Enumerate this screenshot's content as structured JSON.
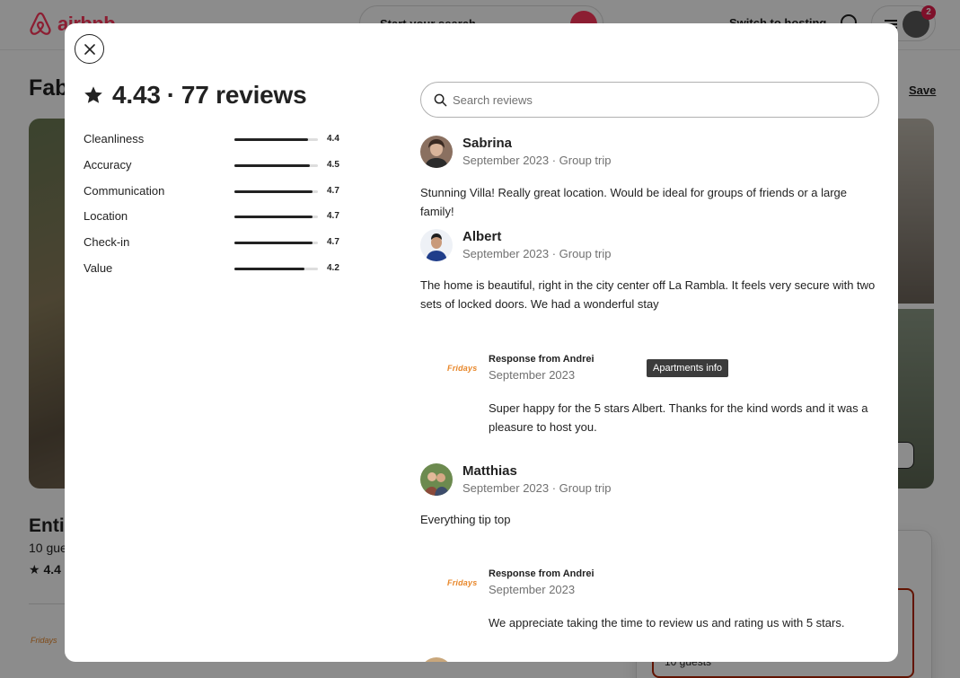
{
  "background": {
    "logo_text": "airbnb",
    "search_placeholder": "Start your search",
    "switch_to_hosting": "Switch to hosting",
    "notification_count": "2",
    "listing_title": "Fab",
    "save_label": "Save",
    "entire_label": "Enti",
    "guests_label": "10 gue",
    "rating_label": "4.4",
    "host_logo": "Fridays",
    "card_guests": "10 guests"
  },
  "modal": {
    "rating": "4.43",
    "separator": "·",
    "reviews_count": "77 reviews",
    "categories": [
      {
        "label": "Cleanliness",
        "value": "4.4",
        "score": 4.4
      },
      {
        "label": "Accuracy",
        "value": "4.5",
        "score": 4.5
      },
      {
        "label": "Communication",
        "value": "4.7",
        "score": 4.7
      },
      {
        "label": "Location",
        "value": "4.7",
        "score": 4.7
      },
      {
        "label": "Check-in",
        "value": "4.7",
        "score": 4.7
      },
      {
        "label": "Value",
        "value": "4.2",
        "score": 4.2
      }
    ],
    "search_placeholder": "Search reviews",
    "reviews": [
      {
        "name": "Sabrina",
        "meta": "September 2023 · Group trip",
        "text": "Stunning Villa! Really great location. Would be ideal for groups of friends or a large family!"
      },
      {
        "name": "Albert",
        "meta": "September 2023 · Group trip",
        "text": "The home is beautiful, right in the city center off La Rambla. It feels very secure with two sets of locked doors. We had a wonderful stay",
        "response": {
          "logo": "Fridays",
          "from": "Response from Andrei",
          "date": "September 2023",
          "text": "Super happy for the 5 stars Albert. Thanks for the kind words and it was a pleasure to host you."
        }
      },
      {
        "name": "Matthias",
        "meta": "September 2023 · Group trip",
        "text": "Everything tip top",
        "response": {
          "logo": "Fridays",
          "from": "Response from Andrei",
          "date": "September 2023",
          "text": "We appreciate taking the time to review us and rating us with 5 stars."
        }
      }
    ],
    "tooltip": "Apartments info"
  },
  "colors": {
    "brand": "#ff385c",
    "text": "#222222",
    "muted": "#717171",
    "host_logo": "#e8872a"
  }
}
